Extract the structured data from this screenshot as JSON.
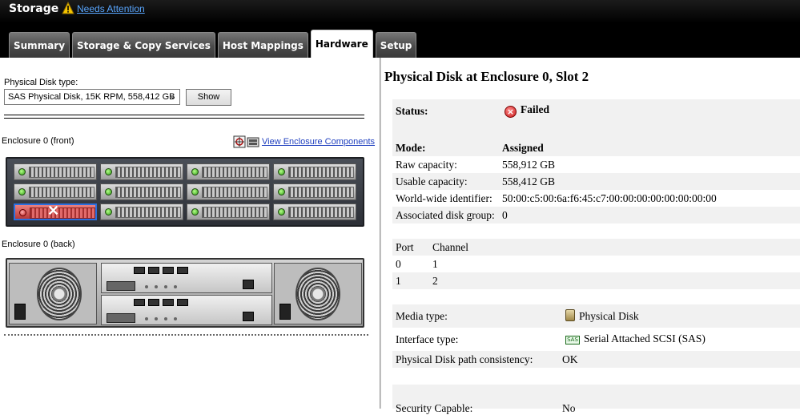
{
  "header": {
    "title": "Storage",
    "warning_link": "Needs Attention"
  },
  "tabs": [
    {
      "label": "Summary"
    },
    {
      "label": "Storage & Copy Services"
    },
    {
      "label": "Host Mappings"
    },
    {
      "label": "Hardware"
    },
    {
      "label": "Setup"
    }
  ],
  "left": {
    "disk_type_label": "Physical Disk type:",
    "disk_type_value": "SAS Physical Disk, 15K RPM, 558,412 GB",
    "show_button": "Show",
    "front_label": "Enclosure 0 (front)",
    "back_label": "Enclosure 0 (back)",
    "view_components_link": "View Enclosure Components",
    "failed_slot": 8,
    "slots": 12
  },
  "right": {
    "title": "Physical Disk at Enclosure 0, Slot 2",
    "status_key": "Status:",
    "status_value": "Failed",
    "mode_key": "Mode:",
    "mode_value": "Assigned",
    "raw_key": "Raw capacity:",
    "raw_value": "558,912 GB",
    "usable_key": "Usable capacity:",
    "usable_value": "558,412 GB",
    "wwid_key": "World-wide identifier:",
    "wwid_value": "50:00:c5:00:6a:f6:45:c7:00:00:00:00:00:00:00:00",
    "assoc_key": "Associated disk group:",
    "assoc_value": "0",
    "port_header": "Port",
    "channel_header": "Channel",
    "ports": [
      {
        "port": "0",
        "channel": "1"
      },
      {
        "port": "1",
        "channel": "2"
      }
    ],
    "media_key": "Media type:",
    "media_value": "Physical Disk",
    "interface_key": "Interface type:",
    "interface_value": "Serial Attached SCSI (SAS)",
    "interface_icon_text": "SAS",
    "consistency_key": "Physical Disk path consistency:",
    "consistency_value": "OK",
    "security_key": "Security Capable:",
    "security_value": "No"
  }
}
